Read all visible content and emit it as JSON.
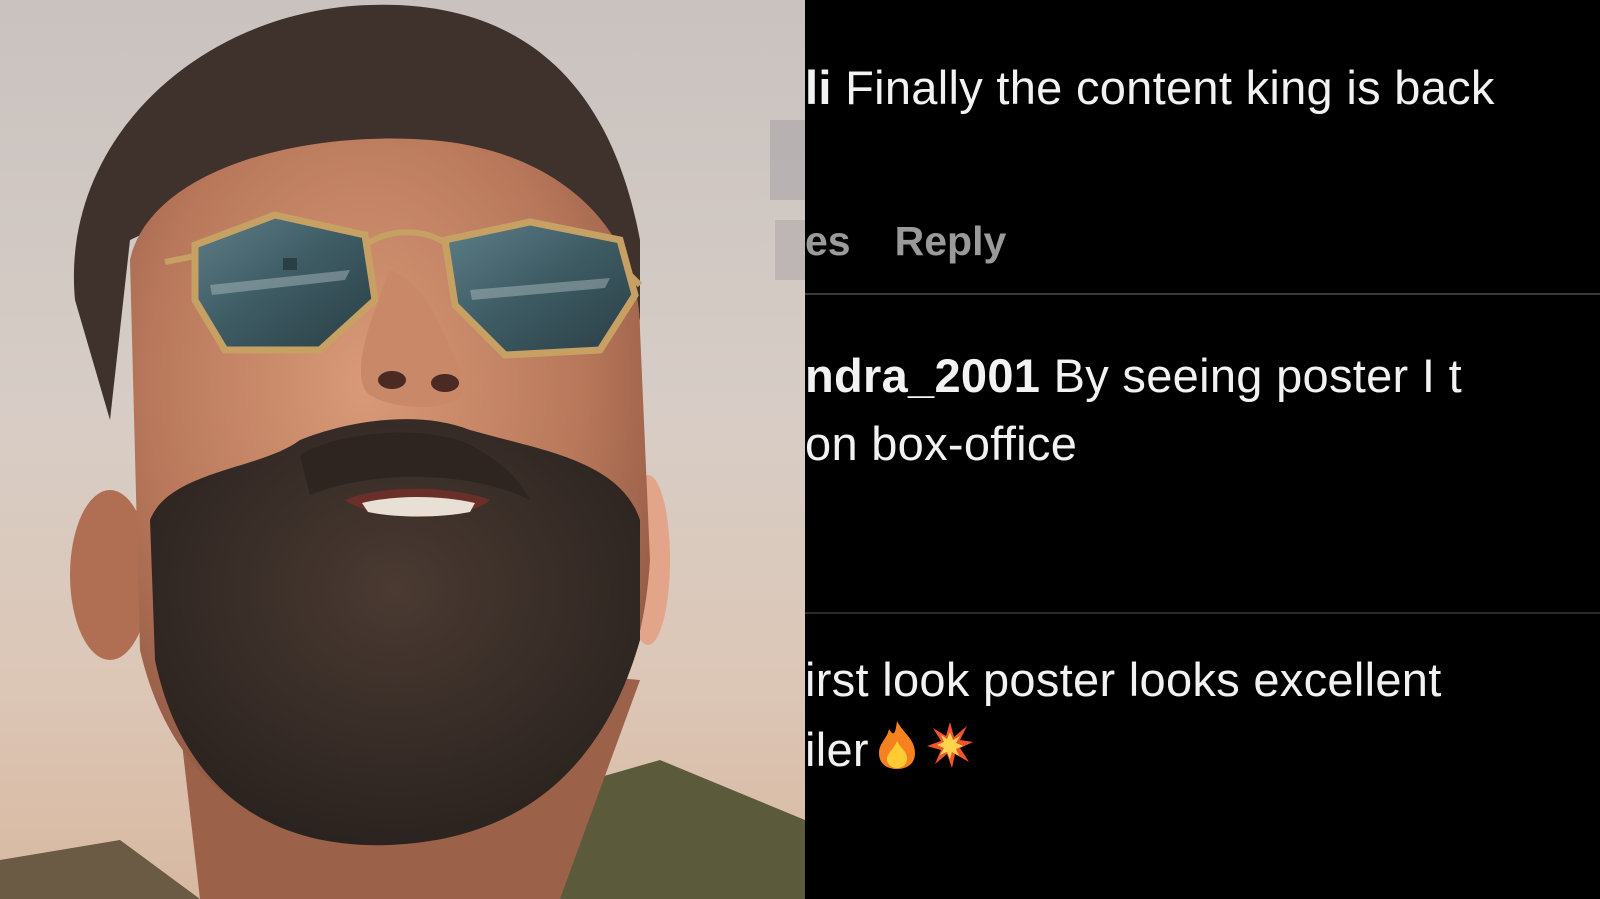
{
  "comments": [
    {
      "username": "li",
      "text": " Finally the content king is back",
      "meta": {
        "time": "es",
        "reply_label": "Reply"
      }
    },
    {
      "username": "ndra_2001",
      "text": " By seeing poster I t",
      "text_line2": "on box-office"
    },
    {
      "text": "irst look poster looks excellent",
      "text_line2": "iler",
      "emojis": [
        "fire-emoji",
        "collision-emoji"
      ]
    }
  ]
}
